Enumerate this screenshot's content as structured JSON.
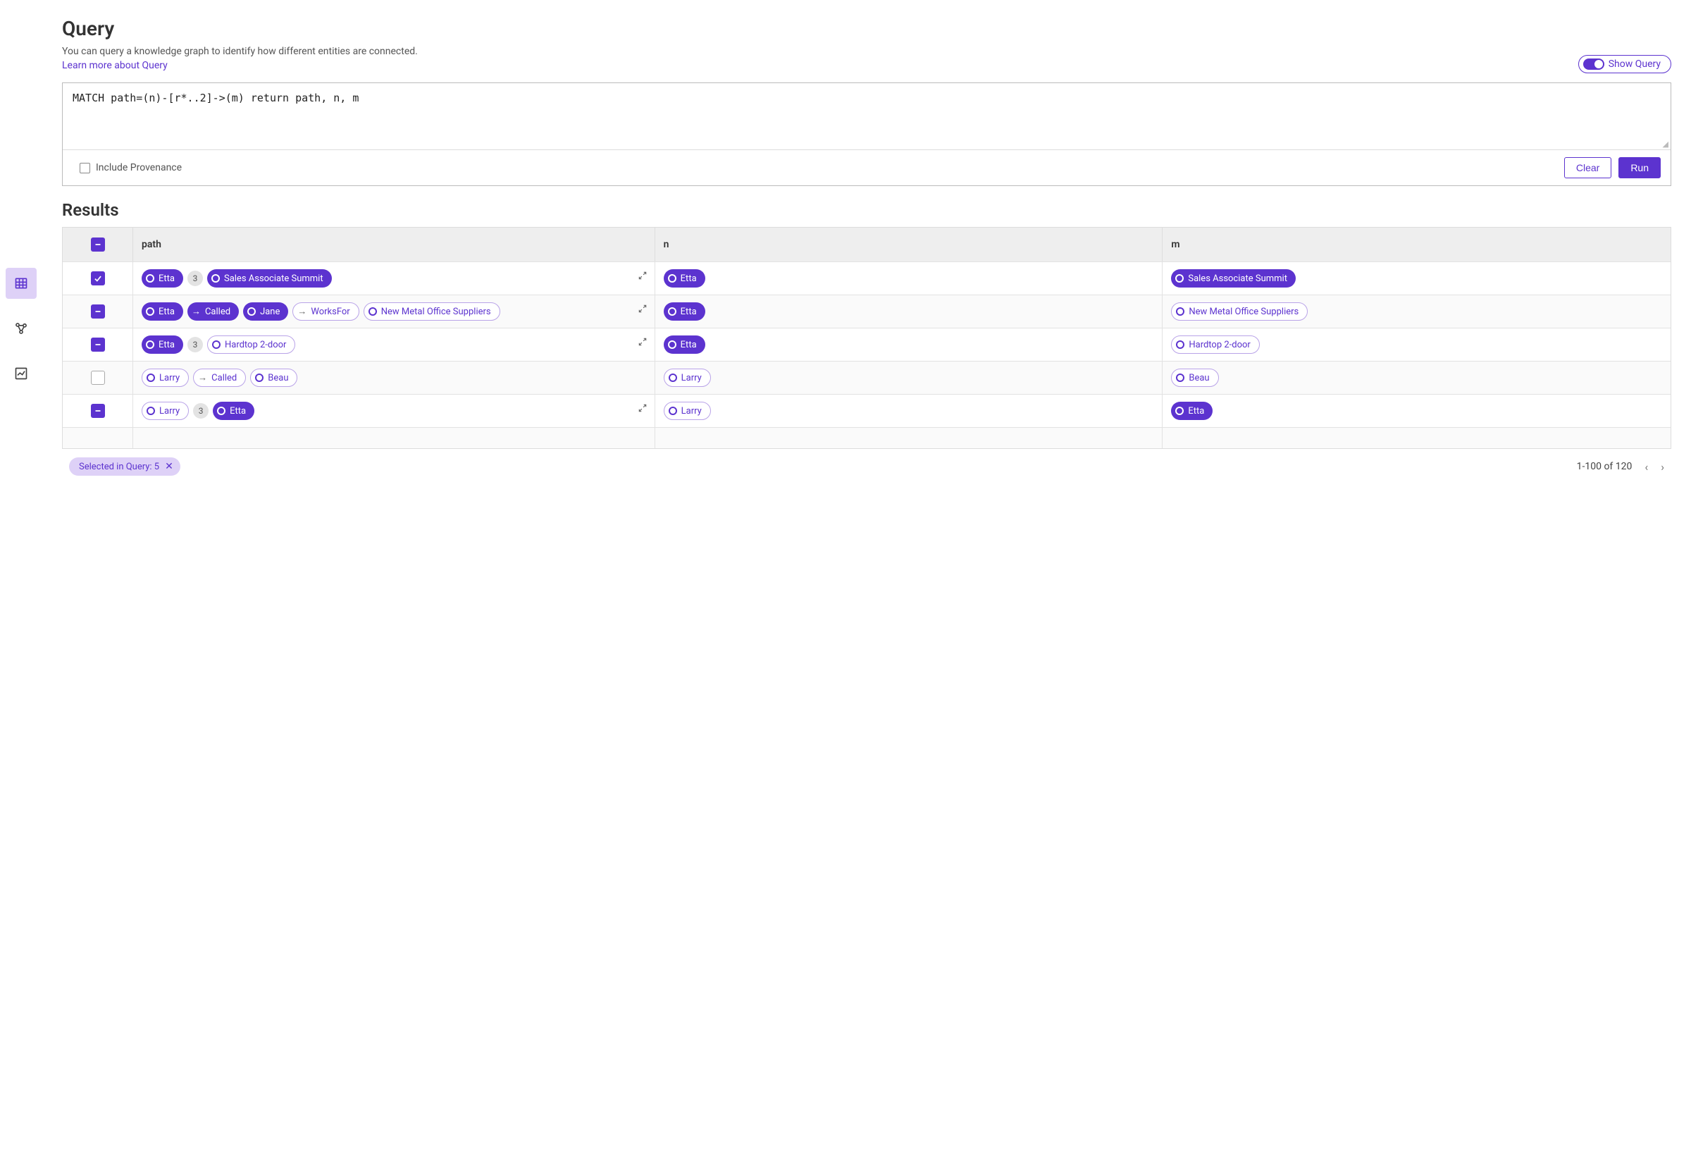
{
  "header": {
    "title": "Query",
    "subtitle": "You can query a knowledge graph to identify how different entities are connected.",
    "learn_link": "Learn more about Query",
    "show_query_label": "Show Query"
  },
  "query": {
    "text": "MATCH path=(n)-[r*..2]->(m) return path, n, m",
    "include_provenance_label": "Include Provenance",
    "clear_label": "Clear",
    "run_label": "Run"
  },
  "results": {
    "title": "Results",
    "columns": {
      "path": "path",
      "n": "n",
      "m": "m"
    },
    "rows": [
      {
        "select": "checked",
        "expand": "expand",
        "path": [
          {
            "kind": "node",
            "style": "solid",
            "label": "Etta"
          },
          {
            "kind": "badge",
            "label": "3"
          },
          {
            "kind": "node",
            "style": "solid",
            "label": "Sales Associate Summit"
          }
        ],
        "n": [
          {
            "kind": "node",
            "style": "solid",
            "label": "Etta"
          }
        ],
        "m": [
          {
            "kind": "node",
            "style": "solid",
            "label": "Sales Associate Summit"
          }
        ]
      },
      {
        "select": "indeterminate",
        "expand": "collapse",
        "path": [
          {
            "kind": "node",
            "style": "solid",
            "label": "Etta"
          },
          {
            "kind": "rel",
            "style": "solid",
            "label": "Called"
          },
          {
            "kind": "node",
            "style": "solid",
            "label": "Jane"
          },
          {
            "kind": "rel",
            "style": "outline",
            "label": "WorksFor"
          },
          {
            "kind": "node",
            "style": "outline",
            "label": "New Metal Office Suppliers"
          }
        ],
        "n": [
          {
            "kind": "node",
            "style": "solid",
            "label": "Etta"
          }
        ],
        "m": [
          {
            "kind": "node",
            "style": "outline",
            "label": "New Metal Office Suppliers"
          }
        ]
      },
      {
        "select": "indeterminate",
        "expand": "expand",
        "path": [
          {
            "kind": "node",
            "style": "solid",
            "label": "Etta"
          },
          {
            "kind": "badge",
            "label": "3"
          },
          {
            "kind": "node",
            "style": "outline",
            "label": "Hardtop 2-door"
          }
        ],
        "n": [
          {
            "kind": "node",
            "style": "solid",
            "label": "Etta"
          }
        ],
        "m": [
          {
            "kind": "node",
            "style": "outline",
            "label": "Hardtop 2-door"
          }
        ]
      },
      {
        "select": "empty",
        "expand": "none",
        "path": [
          {
            "kind": "node",
            "style": "outline",
            "label": "Larry"
          },
          {
            "kind": "rel",
            "style": "outline",
            "label": "Called"
          },
          {
            "kind": "node",
            "style": "outline",
            "label": "Beau"
          }
        ],
        "n": [
          {
            "kind": "node",
            "style": "outline",
            "label": "Larry"
          }
        ],
        "m": [
          {
            "kind": "node",
            "style": "outline",
            "label": "Beau"
          }
        ]
      },
      {
        "select": "indeterminate",
        "expand": "expand",
        "path": [
          {
            "kind": "node",
            "style": "outline",
            "label": "Larry"
          },
          {
            "kind": "badge",
            "label": "3"
          },
          {
            "kind": "node",
            "style": "solid",
            "label": "Etta"
          }
        ],
        "n": [
          {
            "kind": "node",
            "style": "outline",
            "label": "Larry"
          }
        ],
        "m": [
          {
            "kind": "node",
            "style": "solid",
            "label": "Etta"
          }
        ]
      }
    ]
  },
  "footer": {
    "selected_label": "Selected in Query: 5",
    "range_label": "1-100 of 120"
  }
}
